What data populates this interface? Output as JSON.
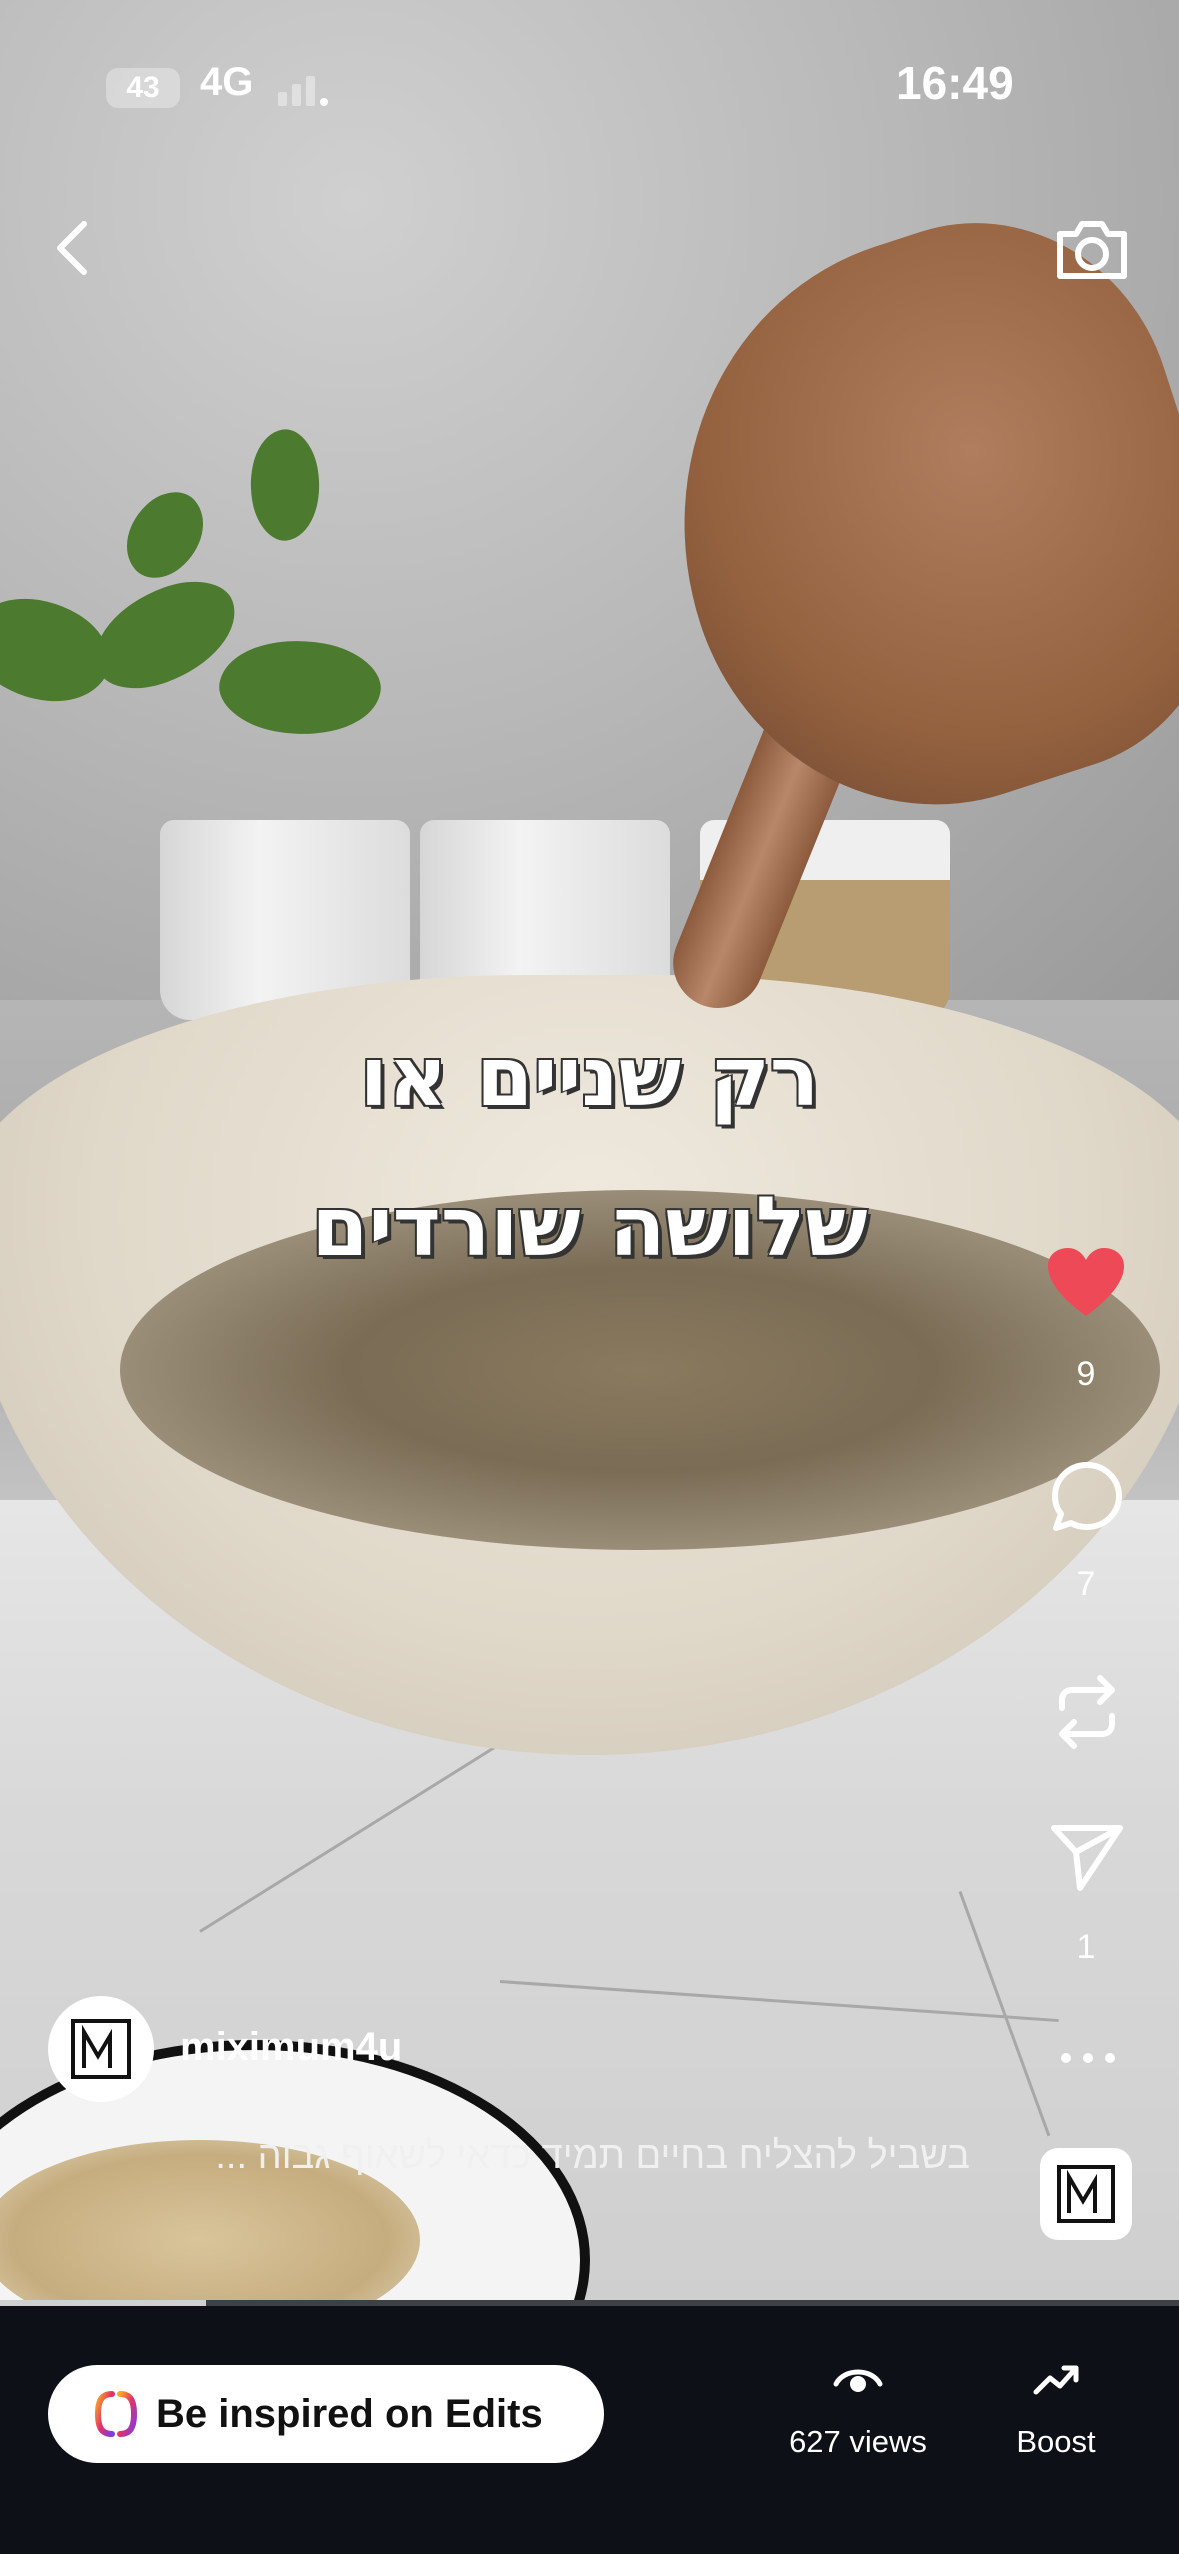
{
  "status_bar": {
    "battery": "43",
    "network": "4G",
    "time": "16:49"
  },
  "video": {
    "overlay_line1": "רק שניים או",
    "overlay_line2": "שלושה שורדים"
  },
  "actions": {
    "likes": "9",
    "comments": "7",
    "shares": "1",
    "like_color": "#ed4956"
  },
  "post": {
    "username": "miximum4u",
    "caption": "בשביל להצליח בחיים תמיד כדאי לשאוף גבוה ..."
  },
  "progress": {
    "fraction": 0.175
  },
  "bottom": {
    "edits_label": "Be inspired on Edits",
    "views_label": "627 views",
    "boost_label": "Boost"
  },
  "icons": [
    "back-icon",
    "camera-icon",
    "heart-icon",
    "comment-icon",
    "repost-icon",
    "send-icon",
    "more-icon",
    "edits-logo-icon",
    "eye-icon",
    "boost-icon"
  ]
}
